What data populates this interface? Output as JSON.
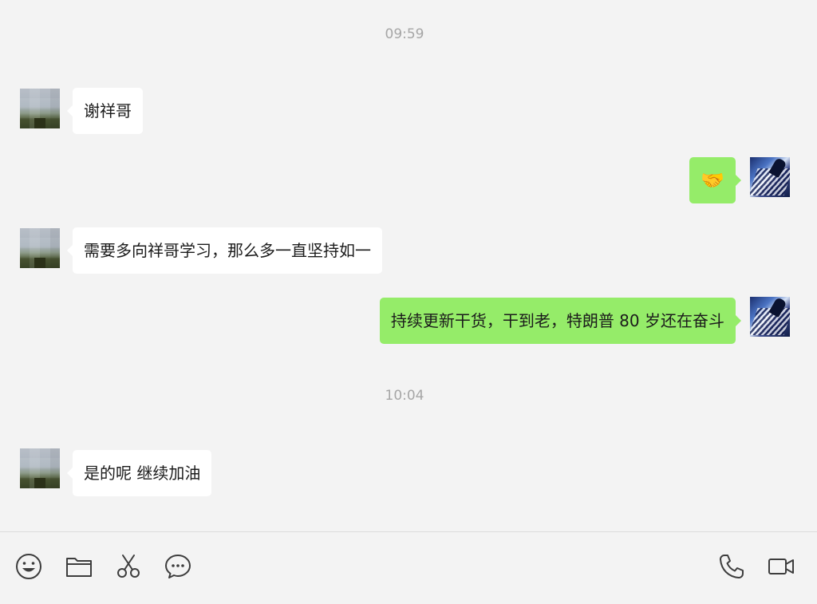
{
  "chat": {
    "timestamps": [
      "09:59",
      "10:04"
    ],
    "messages": [
      {
        "sender": "them",
        "text": "谢祥哥"
      },
      {
        "sender": "me",
        "text": "🤝"
      },
      {
        "sender": "them",
        "text": "需要多向祥哥学习，那么多一直坚持如一"
      },
      {
        "sender": "me",
        "text": "持续更新干货，干到老，特朗普 80 岁还在奋斗"
      },
      {
        "sender": "them",
        "text": "是的呢 继续加油"
      }
    ]
  },
  "toolbar": {
    "left_icons": [
      "emoji-icon",
      "folder-icon",
      "scissors-icon",
      "chat-bubble-icon"
    ],
    "right_icons": [
      "phone-icon",
      "video-call-icon"
    ]
  },
  "colors": {
    "background": "#f3f3f3",
    "sent_bubble": "#95ec69",
    "received_bubble": "#ffffff",
    "timestamp": "#a6a6a6",
    "icon": "#3d3d3d"
  }
}
